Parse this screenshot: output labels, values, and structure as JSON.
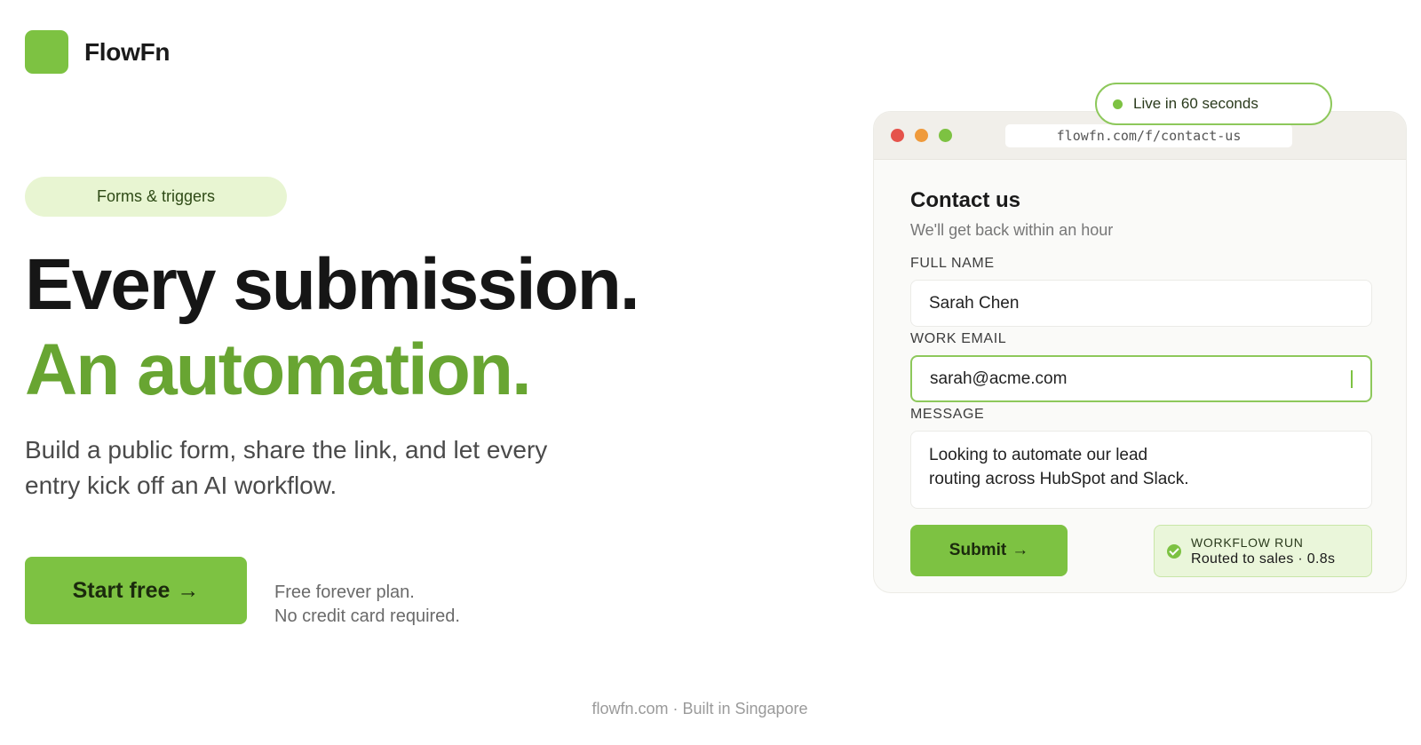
{
  "brand": {
    "name": "FlowFn",
    "color": "#7dc242"
  },
  "hero": {
    "tag": "Forms & triggers",
    "headline_1": "Every submission.",
    "headline_2": "An automation.",
    "subcopy": "Build a public form, share the link, and let every entry kick off an AI workflow.",
    "cta_label": "Start free",
    "cta_arrow": "→",
    "cta_note_1": "Free forever plan.",
    "cta_note_2": "No credit card required."
  },
  "preview": {
    "badge": "Live in 60 seconds",
    "url": "flowfn.com/f/contact-us",
    "form": {
      "title": "Contact us",
      "subtitle": "We'll get back within an hour",
      "name_label": "FULL NAME",
      "name_value": "Sarah Chen",
      "email_label": "WORK EMAIL",
      "email_value": "sarah@acme.com",
      "message_label": "MESSAGE",
      "message_line_1": "Looking to automate our lead",
      "message_line_2": "routing across HubSpot and Slack.",
      "submit_label": "Submit",
      "submit_arrow": "→"
    },
    "workflow": {
      "title": "WORKFLOW RUN",
      "detail": "Routed to sales · 0.8s"
    }
  },
  "footer": {
    "text": "flowfn.com · Built in Singapore"
  },
  "colors": {
    "accent": "#7dc242",
    "accent_text": "#68a532",
    "tag_bg": "#e8f5d2"
  }
}
